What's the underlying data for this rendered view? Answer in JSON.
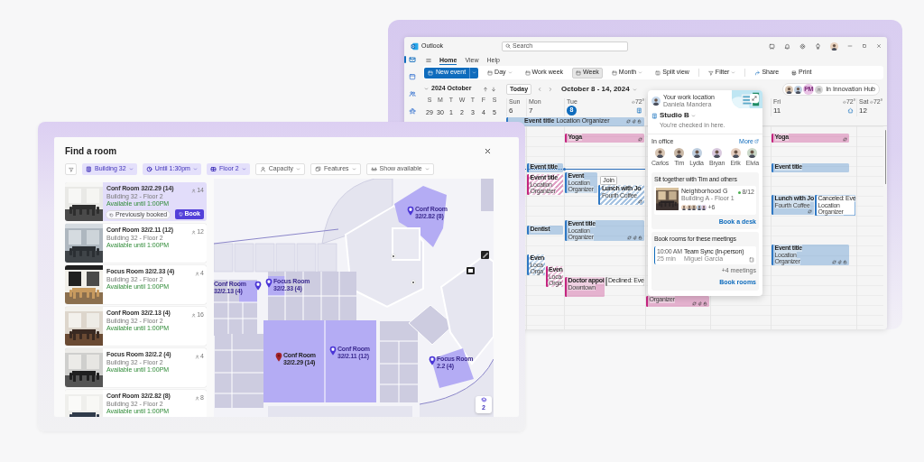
{
  "outlook": {
    "app_name": "Outlook",
    "search": {
      "placeholder": "Search"
    },
    "nav_rail": [
      {
        "selected": true
      },
      {
        "selected": false
      },
      {
        "selected": false
      },
      {
        "selected": false
      }
    ],
    "ribbon_tabs": [
      {
        "label": "Home",
        "selected": true
      },
      {
        "label": "View",
        "selected": false
      },
      {
        "label": "Help",
        "selected": false
      }
    ],
    "toolbar": [
      {
        "kind": "primary",
        "label": "New event"
      },
      {
        "kind": "view",
        "label": "Day",
        "selected": false,
        "dropdown": true
      },
      {
        "kind": "view",
        "label": "Work week",
        "selected": false,
        "dropdown": false
      },
      {
        "kind": "view",
        "label": "Week",
        "selected": true,
        "dropdown": false
      },
      {
        "kind": "view",
        "label": "Month",
        "selected": false,
        "dropdown": true
      },
      {
        "kind": "view",
        "label": "Split view",
        "selected": false,
        "dropdown": false
      },
      {
        "kind": "action",
        "label": "Filter",
        "dropdown": true
      },
      {
        "kind": "action",
        "label": "Share",
        "dropdown": false
      },
      {
        "kind": "action",
        "label": "Print",
        "dropdown": false
      }
    ],
    "mini_calendar": {
      "month": "2024 October",
      "weekdays": [
        "S",
        "M",
        "T",
        "W",
        "T",
        "F",
        "S"
      ],
      "days": [
        "29",
        "30",
        "1",
        "2",
        "3",
        "4",
        "5"
      ]
    },
    "calendar": {
      "today_button": "Today",
      "range": "October 8 - 14, 2024",
      "presence": {
        "initials": "PM",
        "label": "In Innovation Hub"
      },
      "all_day": {
        "text": "**Event title** Location Organizer",
        "color": "#2f78c4",
        "recurring": true,
        "has_attachment": true,
        "private": true
      },
      "days": [
        {
          "weekday": "Sun",
          "date": "6",
          "selected": false
        },
        {
          "weekday": "Mon",
          "date": "7",
          "selected": false,
          "events": [
            {
              "kind": "busy",
              "title": "Event title",
              "color": "#2f78c4"
            },
            {
              "kind": "tentative",
              "title": "Event title",
              "lines": [
                "Location",
                "Organizer"
              ],
              "color": "#c4257f"
            },
            {
              "kind": "busy",
              "title": "Dentist",
              "color": "#2f78c4"
            },
            {
              "kind": "tentative",
              "title": "Even",
              "lines": [
                "Loca",
                "Orga"
              ],
              "color": "#2f78c4"
            },
            {
              "kind": "tentative",
              "title": "Even",
              "lines": [
                "Loca",
                "Orga"
              ],
              "color": "#c4257f"
            }
          ]
        },
        {
          "weekday": "Tue",
          "date": "8",
          "selected": true,
          "weather": "72°",
          "in_office": true,
          "events": [
            {
              "kind": "busy",
              "title": "Yoga",
              "color": "#c4257f",
              "recurring": true
            },
            {
              "kind": "busy",
              "title": "Event",
              "lines": [
                "Location",
                "Organizer"
              ],
              "color": "#2f78c4",
              "join": "Join"
            },
            {
              "kind": "tentative",
              "title": "Lunch with Jo",
              "lines": [
                "Fourth Coffee"
              ],
              "color": "#2f78c4",
              "recurring": true
            },
            {
              "kind": "busy",
              "title": "Event title",
              "lines": [
                "Location",
                "Organizer"
              ],
              "color": "#2f78c4",
              "recurring": true,
              "has_attachment": true,
              "private": true
            },
            {
              "kind": "busy",
              "title": "Doctor appoi",
              "lines": [
                "Downtown"
              ],
              "color": "#c4257f"
            },
            {
              "kind": "declined",
              "title": "Declined: Eve",
              "color": "#8a8a8a"
            }
          ]
        },
        {
          "events": [
            {
              "kind": "busy",
              "lines": [
                "Organizer"
              ],
              "color": "#c4257f",
              "recurring": true,
              "has_attachment": true,
              "private": true
            }
          ]
        },
        {
          "weekday": "Fri",
          "date": "11",
          "selected": false,
          "weather": "72°",
          "working_from_home": true,
          "events": [
            {
              "kind": "busy",
              "title": "Yoga",
              "color": "#c4257f",
              "recurring": true
            },
            {
              "kind": "busy",
              "title": "Event title",
              "color": "#2f78c4"
            },
            {
              "kind": "busy",
              "title": "Lunch with Jo",
              "lines": [
                "Fourth Coffee"
              ],
              "color": "#2f78c4",
              "recurring": true
            },
            {
              "kind": "canceled",
              "title": "Canceled: Eve",
              "lines": [
                "Location",
                "Organizer"
              ],
              "color": "#2f78c4"
            },
            {
              "kind": "busy",
              "title": "Event title",
              "lines": [
                "Location",
                "Organizer"
              ],
              "color": "#2f78c4",
              "recurring": true,
              "has_attachment": true,
              "private": true
            }
          ]
        },
        {
          "weekday": "Sat",
          "date": "12",
          "selected": false,
          "weather": "72°"
        }
      ]
    },
    "location_card": {
      "caption": "Your work location",
      "person": "Daniela Mandera",
      "place": "Studio B",
      "status": "You're checked in here.",
      "in_office": {
        "heading": "In office",
        "more": "More",
        "people": [
          "Carlos",
          "Tim",
          "Lydia",
          "Bryan",
          "Erik",
          "Elvia"
        ]
      },
      "sit_together": {
        "heading": "Sit together with Tim and others",
        "space": "Neighborhood G",
        "count": "8/12",
        "location": "Building A - Floor 1",
        "more_people": "+6",
        "action": "Book a desk"
      },
      "book_rooms": {
        "heading": "Book rooms for these meetings",
        "meetings": [
          {
            "time": "10:00 AM",
            "duration": "25 min",
            "title": "Team Sync (In-person)",
            "organizer": "Miguel Garcia"
          }
        ],
        "more": "+4 meetings",
        "action": "Book rooms"
      }
    }
  },
  "find_room": {
    "title": "Find a room",
    "filters": [
      {
        "label": "Building 32",
        "selected": true
      },
      {
        "label": "Until 1:30pm",
        "selected": true
      },
      {
        "label": "Floor 2",
        "selected": true
      },
      {
        "label": "Capacity",
        "selected": false
      },
      {
        "label": "Features",
        "selected": false
      },
      {
        "label": "Show available",
        "selected": false
      }
    ],
    "rooms": [
      {
        "name": "Conf Room 32/2.29 (14)",
        "location": "Building 32 - Floor 2",
        "availability": "Available until 1:00PM",
        "capacity": "14",
        "selected": true,
        "note": "Previously booked",
        "action": "Book"
      },
      {
        "name": "Conf Room 32/2.11 (12)",
        "location": "Building 32 - Floor 2",
        "availability": "Available until 1:00PM",
        "capacity": "12",
        "selected": false
      },
      {
        "name": "Focus Room 32/2.33 (4)",
        "location": "Building 32 - Floor 2",
        "availability": "Available until 1:00PM",
        "capacity": "4",
        "selected": false
      },
      {
        "name": "Conf Room 32/2.13 (4)",
        "location": "Building 32 - Floor 2",
        "availability": "Available until 1:00PM",
        "capacity": "16",
        "selected": false
      },
      {
        "name": "Focus Room 32/2.2 (4)",
        "location": "Building 32 - Floor 2",
        "availability": "Available until 1:00PM",
        "capacity": "4",
        "selected": false
      },
      {
        "name": "Conf Room 32/2.82 (8)",
        "location": "Building 32 - Floor 2",
        "availability": "Available until 1:00PM",
        "capacity": "8",
        "selected": false
      }
    ],
    "map": {
      "pins": [
        {
          "label": "Conf Room 32/2.82 (8)",
          "selected": false
        },
        {
          "label": "Conf Room 32/2.13 (4)",
          "selected": false
        },
        {
          "label": "Focus Room 32/2.33 (4)",
          "selected": false
        },
        {
          "label": "Conf Room 32/2.29 (14)",
          "selected": true
        },
        {
          "label": "Conf Room 32/2.11 (12)",
          "selected": false
        },
        {
          "label": "Focus Room 2.2 (4)",
          "selected": false
        }
      ],
      "floor": "2"
    }
  }
}
